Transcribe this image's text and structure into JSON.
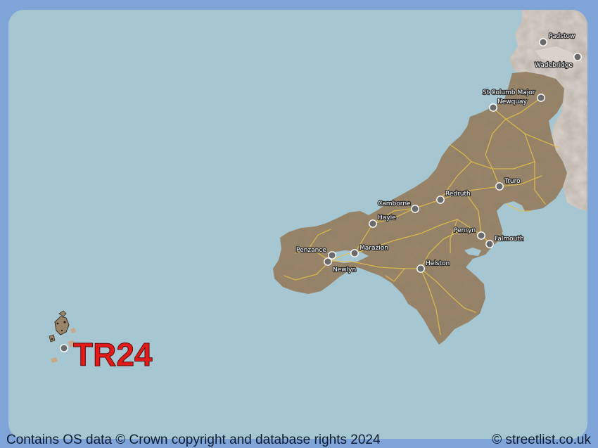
{
  "map": {
    "postcode_label": "TR24",
    "colors": {
      "sea": "#a6c7d2",
      "land_highlight": "#9a8568",
      "land_grey": "#d9d2cb",
      "roads": "#e2bf4a",
      "frame": "#7ea4d8",
      "postcode_label": "#e21a1a"
    },
    "towns": {
      "padstow": "Padstow",
      "wadebridge": "Wadebridge",
      "st_columb_major": "St Columb Major",
      "newquay": "Newquay",
      "truro": "Truro",
      "redruth": "Redruth",
      "camborne": "Camborne",
      "hayle": "Hayle",
      "penryn": "Penryn",
      "falmouth": "Falmouth",
      "penzance": "Penzance",
      "marazion": "Marazion",
      "newlyn": "Newlyn",
      "helston": "Helston"
    }
  },
  "footer": {
    "attribution": "Contains OS data © Crown copyright and database rights 2024",
    "site_credit": "© streetlist.co.uk"
  }
}
